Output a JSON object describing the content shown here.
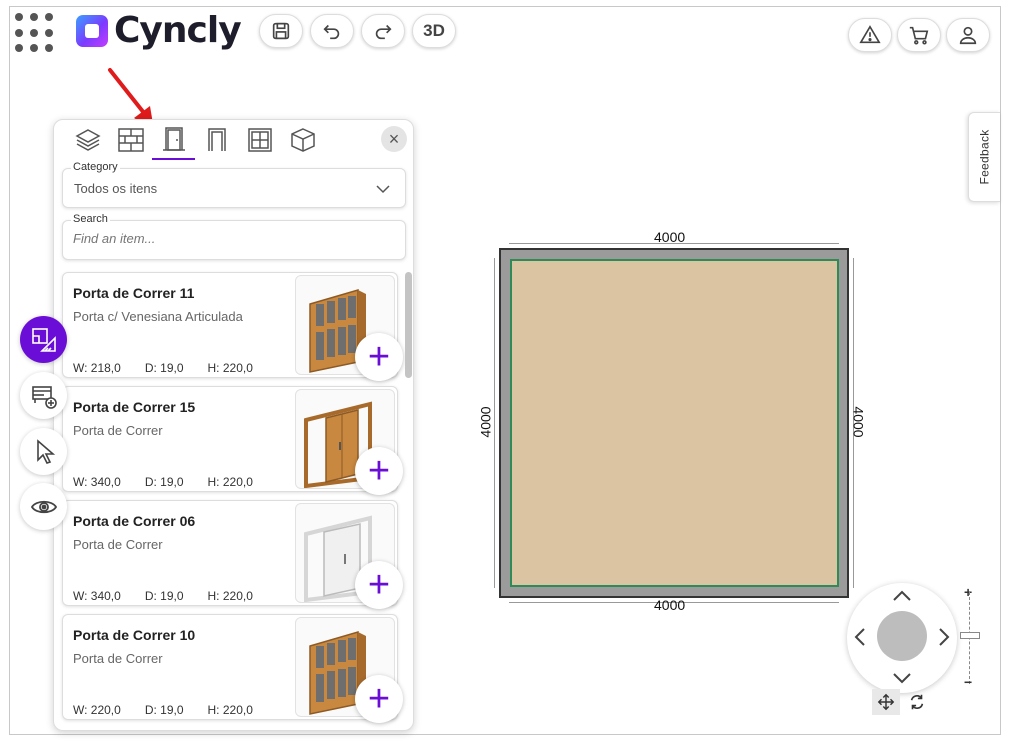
{
  "app": {
    "brand": "Cyncly",
    "accent": "#6a0dd6"
  },
  "toolbar": {
    "save_icon": "floppy-disk-icon",
    "undo_icon": "undo-icon",
    "redo_icon": "redo-icon",
    "view3d_label": "3D",
    "warning_icon": "warning-triangle-icon",
    "cart_icon": "cart-icon",
    "user_icon": "user-icon"
  },
  "panel": {
    "tabs": [
      {
        "icon": "layers-icon"
      },
      {
        "icon": "brick-wall-icon"
      },
      {
        "icon": "door-icon",
        "active": true
      },
      {
        "icon": "opening-icon"
      },
      {
        "icon": "window-icon"
      },
      {
        "icon": "cube-icon"
      }
    ],
    "category": {
      "label": "Category",
      "value": "Todos os itens"
    },
    "search": {
      "label": "Search",
      "placeholder": "Find an item..."
    },
    "items": [
      {
        "title": "Porta de Correr 11",
        "subtitle": "Porta c/ Venesiana Articulada",
        "w": "W: 218,0",
        "d": "D: 19,0",
        "h": "H: 220,0",
        "style": "wood-grid"
      },
      {
        "title": "Porta de Correr 15",
        "subtitle": "Porta de Correr",
        "w": "W: 340,0",
        "d": "D: 19,0",
        "h": "H: 220,0",
        "style": "wood-open"
      },
      {
        "title": "Porta de Correr 06",
        "subtitle": "Porta de Correr",
        "w": "W: 340,0",
        "d": "D: 19,0",
        "h": "H: 220,0",
        "style": "white-open"
      },
      {
        "title": "Porta de Correr 10",
        "subtitle": "Porta de Correr",
        "w": "W: 220,0",
        "d": "D: 19,0",
        "h": "H: 220,0",
        "style": "wood-grid"
      }
    ],
    "add_symbol": "+"
  },
  "rail": [
    {
      "icon": "floorplan-icon",
      "active": true
    },
    {
      "icon": "add-furniture-icon"
    },
    {
      "icon": "pointer-icon"
    },
    {
      "icon": "eye-icon"
    }
  ],
  "feedback": {
    "label": "Feedback"
  },
  "floorplan": {
    "top": "4000",
    "bottom": "4000",
    "left": "4000",
    "right": "4000",
    "floor_color": "#dbc4a2",
    "wall_color": "#9b9b9b"
  },
  "navigation": {
    "zoom_in": "+",
    "zoom_out": "−",
    "move_icon": "move-icon",
    "rotate_icon": "rotate-icon"
  }
}
